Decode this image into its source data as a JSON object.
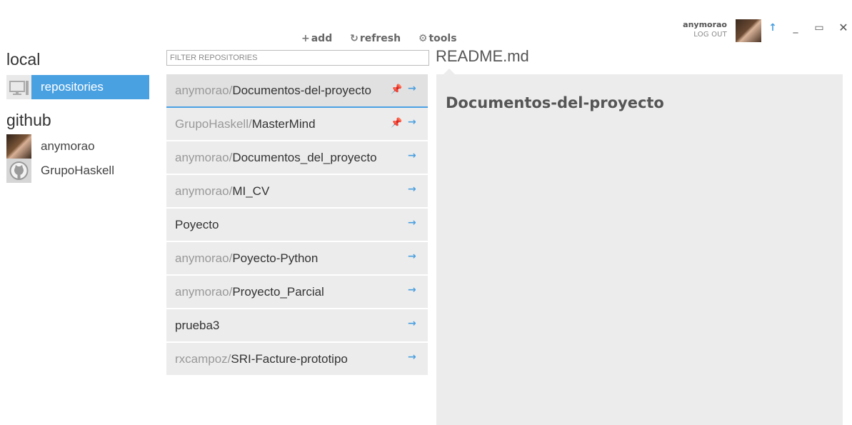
{
  "user": {
    "name": "anymorao",
    "logout_label": "LOG OUT"
  },
  "window": {
    "sync_icon": "↑",
    "minimize_icon": "_",
    "maximize_icon": "▭",
    "close_icon": "✕"
  },
  "sidebar": {
    "local_title": "local",
    "local_items": [
      {
        "label": "repositories",
        "icon": "computer-icon",
        "active": true
      }
    ],
    "github_title": "github",
    "github_items": [
      {
        "label": "anymorao",
        "icon": "user-avatar"
      },
      {
        "label": "GrupoHaskell",
        "icon": "github-octocat-icon"
      }
    ]
  },
  "toolbar": {
    "add_label": "add",
    "refresh_label": "refresh",
    "tools_label": "tools"
  },
  "filter": {
    "placeholder": "FILTER REPOSITORIES",
    "value": ""
  },
  "repos": [
    {
      "owner": "anymorao/",
      "name": "Documentos-del-proyecto",
      "pinned": true,
      "selected": true
    },
    {
      "owner": "GrupoHaskell/",
      "name": "MasterMind",
      "pinned": true,
      "selected": false
    },
    {
      "owner": "anymorao/",
      "name": "Documentos_del_proyecto",
      "pinned": false,
      "selected": false
    },
    {
      "owner": "anymorao/",
      "name": "MI_CV",
      "pinned": false,
      "selected": false
    },
    {
      "owner": "",
      "name": "Poyecto",
      "pinned": false,
      "selected": false
    },
    {
      "owner": "anymorao/",
      "name": "Poyecto-Python",
      "pinned": false,
      "selected": false
    },
    {
      "owner": "anymorao/",
      "name": "Proyecto_Parcial",
      "pinned": false,
      "selected": false
    },
    {
      "owner": "",
      "name": "prueba3",
      "pinned": false,
      "selected": false
    },
    {
      "owner": "rxcampoz/",
      "name": "SRI-Facture-prototipo",
      "pinned": false,
      "selected": false
    }
  ],
  "readme": {
    "title": "README.md",
    "heading": "Documentos-del-proyecto"
  },
  "colors": {
    "accent": "#4aa1e2",
    "panel": "#ececec"
  }
}
